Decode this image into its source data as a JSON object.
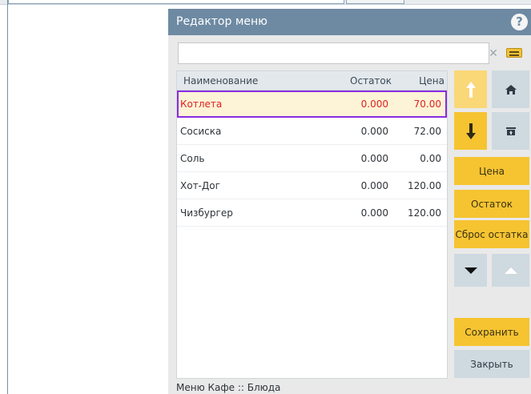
{
  "dialog": {
    "title": "Редактор меню",
    "help_icon": "?"
  },
  "search": {
    "value": "",
    "placeholder": ""
  },
  "table": {
    "columns": [
      "Наименование",
      "Остаток",
      "Цена"
    ],
    "rows": [
      {
        "name": "Котлета",
        "stock": "0.000",
        "price": "70.00"
      },
      {
        "name": "Сосиска",
        "stock": "0.000",
        "price": "72.00"
      },
      {
        "name": "Соль",
        "stock": "0.000",
        "price": "0.00"
      },
      {
        "name": "Хот-Дог",
        "stock": "0.000",
        "price": "120.00"
      },
      {
        "name": "Чизбургер",
        "stock": "0.000",
        "price": "120.00"
      }
    ]
  },
  "buttons": {
    "price": "Цена",
    "stock": "Остаток",
    "reset_stock": "Сброс остатка",
    "save": "Сохранить",
    "close": "Закрыть"
  },
  "icons": {
    "up": "arrow-up-icon",
    "down": "arrow-down-icon",
    "home": "home-icon",
    "folder": "folder-icon",
    "page_down": "triangle-down-icon",
    "page_up": "triangle-up-icon"
  },
  "status": {
    "breadcrumb": "Меню Кафе :: Блюда"
  },
  "colors": {
    "titlebar": "#6e8aa3",
    "accent": "#f6c431",
    "selection_text": "#e02020",
    "selection_border": "#8a2be2"
  }
}
